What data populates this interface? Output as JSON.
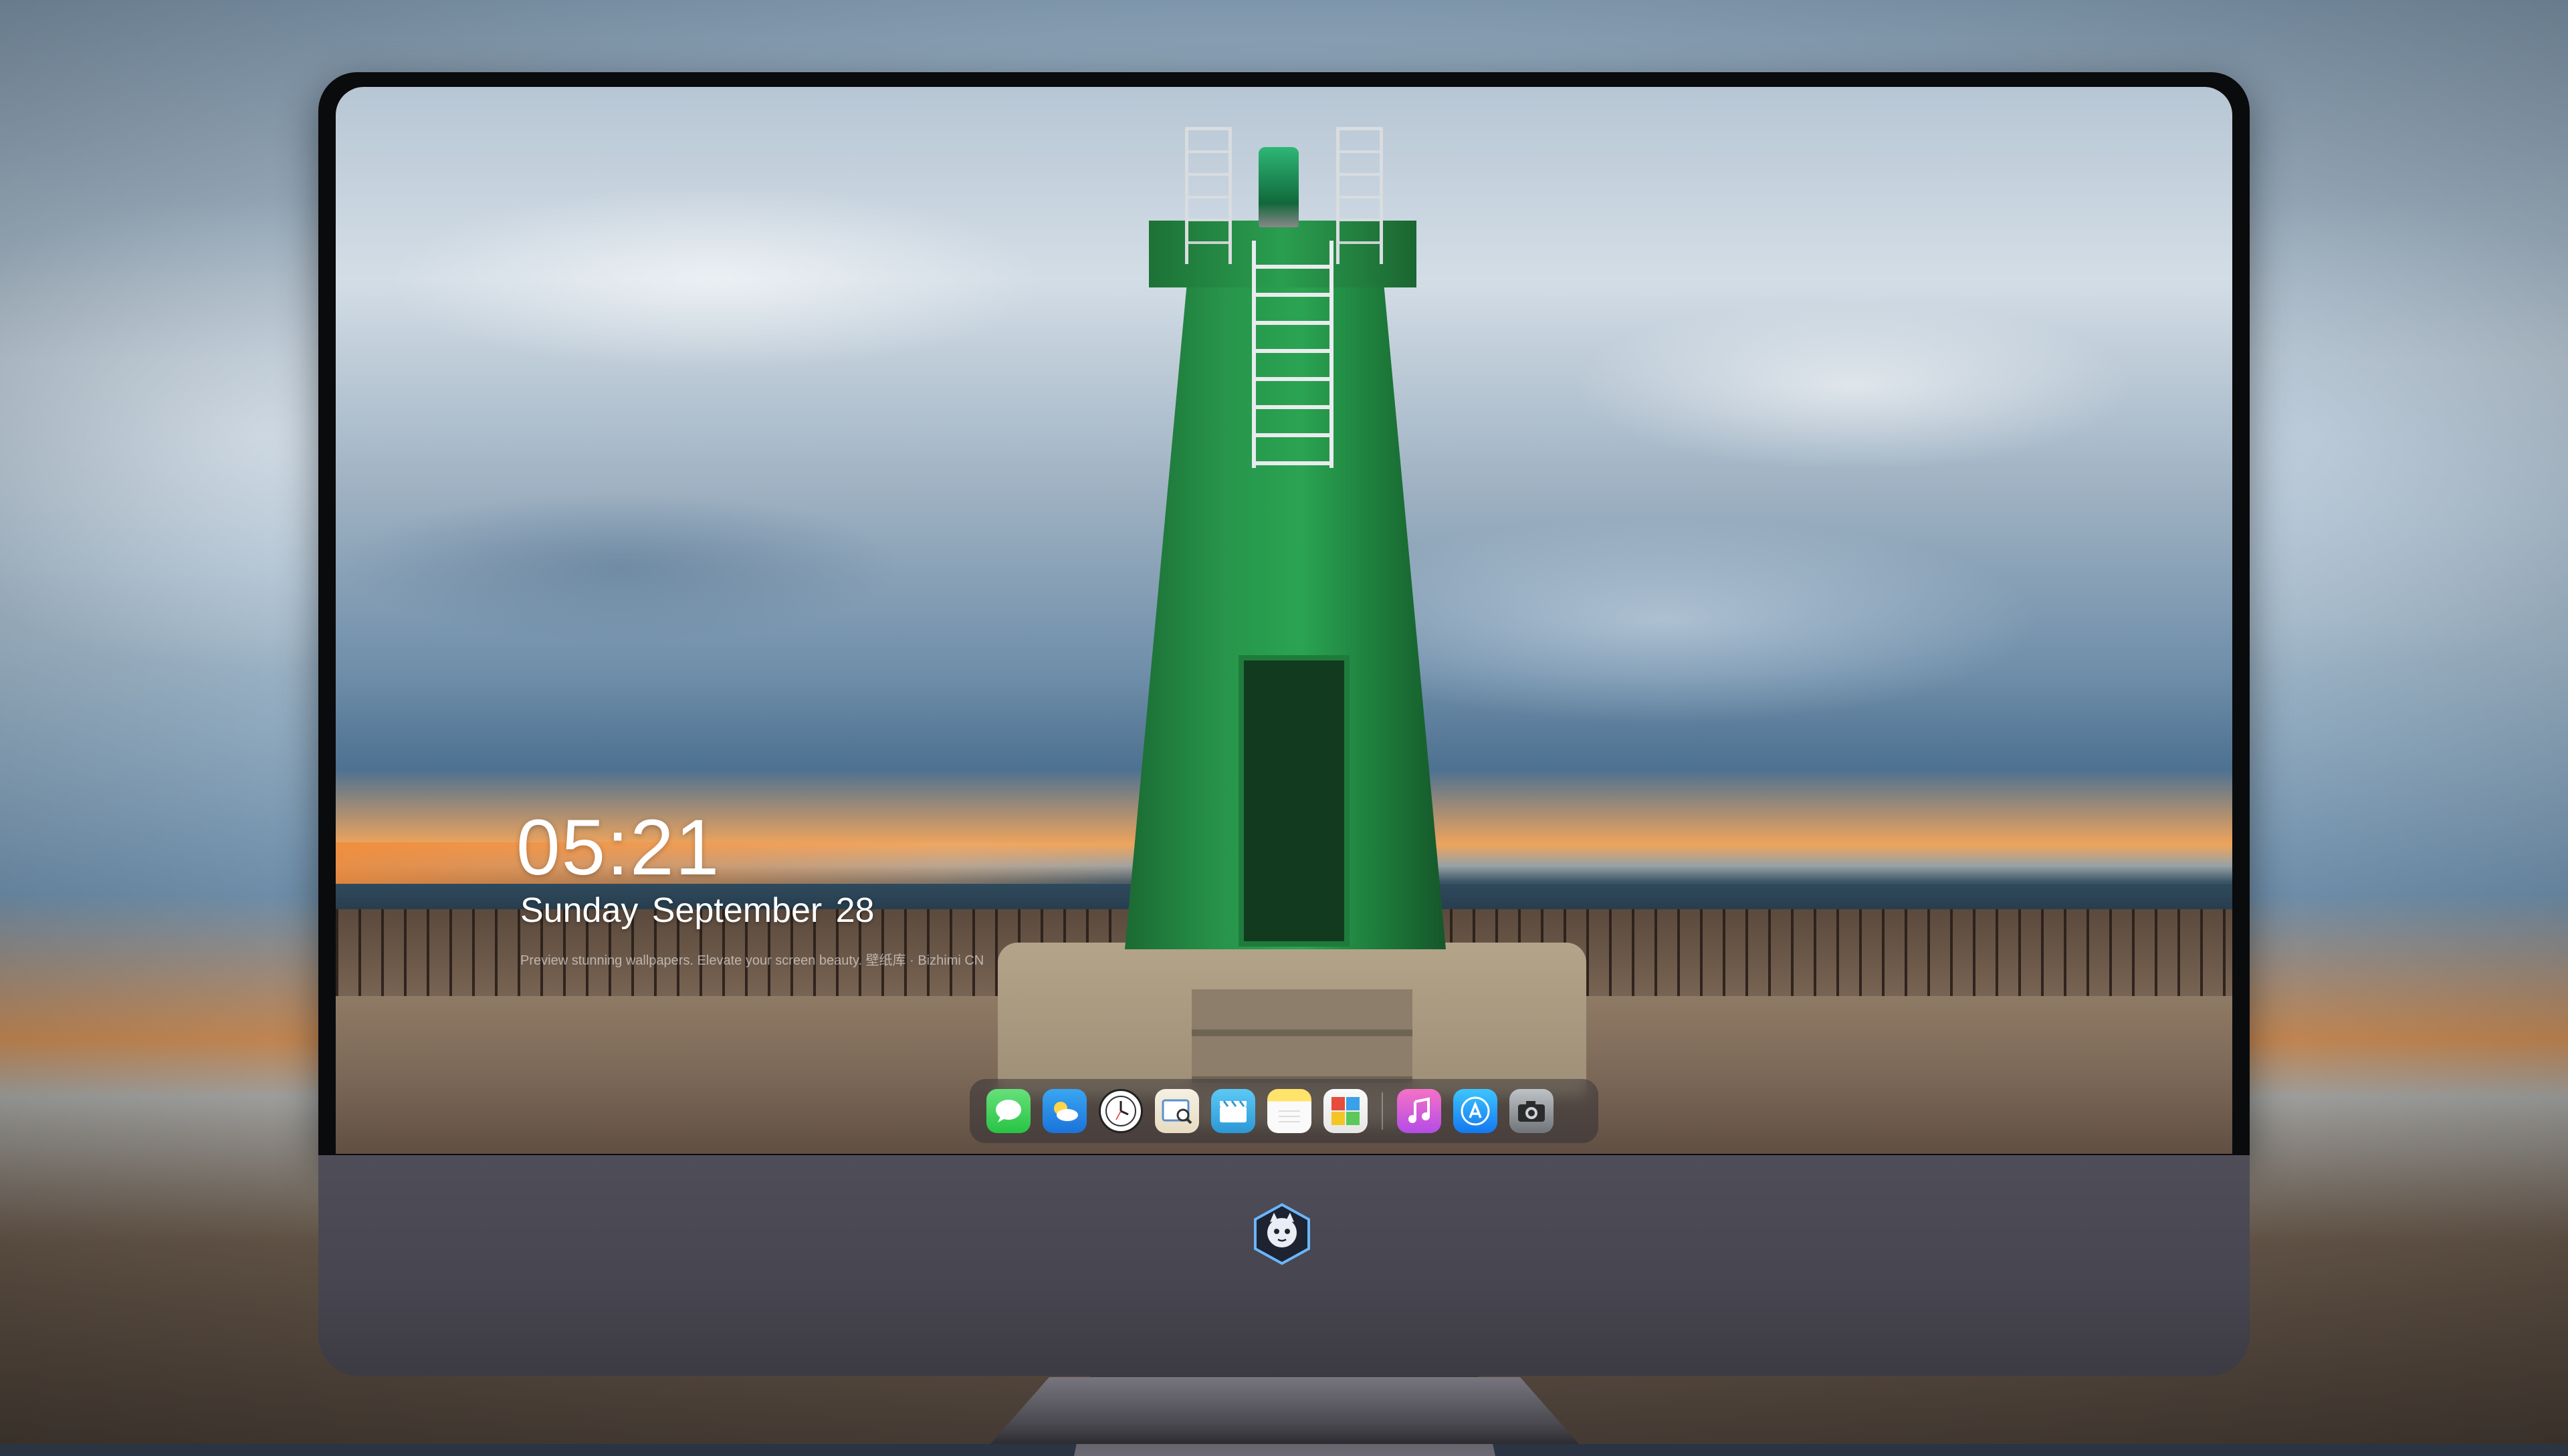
{
  "lock_screen": {
    "time": "05:21",
    "date": "Sunday September  28",
    "caption": "Preview stunning wallpapers. Elevate your screen beauty. 壁纸库 · Bizhimi CN"
  },
  "dock": {
    "apps": [
      {
        "name": "Messages",
        "icon": "messages-icon"
      },
      {
        "name": "Weather",
        "icon": "weather-icon"
      },
      {
        "name": "Clock",
        "icon": "clock-icon"
      },
      {
        "name": "Preview",
        "icon": "preview-icon"
      },
      {
        "name": "Clips",
        "icon": "clips-icon"
      },
      {
        "name": "Notes",
        "icon": "notes-icon"
      },
      {
        "name": "Photo Booth",
        "icon": "photo-booth-icon"
      },
      {
        "name": "Music",
        "icon": "music-icon"
      },
      {
        "name": "App Store",
        "icon": "app-store-icon"
      },
      {
        "name": "Camera",
        "icon": "camera-icon"
      }
    ]
  },
  "colors": {
    "lighthouse_green": "#2aa452",
    "monitor_chin": "#4f4d57",
    "clock_text": "#ffffff"
  }
}
